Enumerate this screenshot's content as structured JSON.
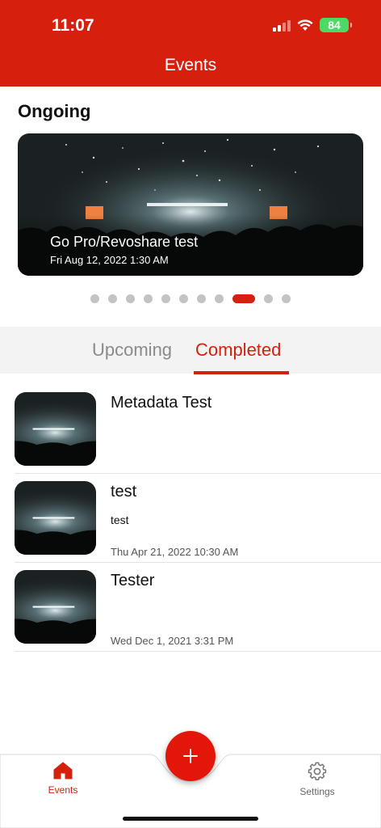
{
  "status_bar": {
    "time": "11:07",
    "battery": "84"
  },
  "header": {
    "title": "Events"
  },
  "ongoing": {
    "section_title": "Ongoing",
    "event": {
      "title": "Go Pro/Revoshare test",
      "date": "Fri Aug 12, 2022 1:30 AM"
    },
    "carousel": {
      "page_count": 11,
      "active_index": 8
    }
  },
  "tabs": [
    {
      "label": "Upcoming",
      "selected": false
    },
    {
      "label": "Completed",
      "selected": true
    }
  ],
  "events": [
    {
      "title": "Metadata Test",
      "subtitle": "",
      "date": ""
    },
    {
      "title": "test",
      "subtitle": "test",
      "date": "Thu Apr 21, 2022 10:30 AM"
    },
    {
      "title": "Tester",
      "subtitle": "",
      "date": "Wed Dec 1, 2021 3:31 PM"
    }
  ],
  "bottom_nav": {
    "events_label": "Events",
    "settings_label": "Settings",
    "add_icon": "plus-icon"
  },
  "colors": {
    "accent": "#d71f0e",
    "inactive": "#8a8a8a"
  }
}
